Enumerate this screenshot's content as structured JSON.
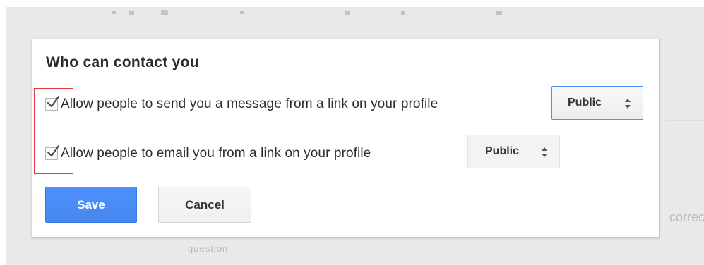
{
  "background": {
    "right_fragment": "correc",
    "bottom_fragment": "question"
  },
  "dialog": {
    "title": "Who can contact you",
    "options": [
      {
        "label": "Allow people to send you a message from a link on your profile",
        "checked": true,
        "visibility": "Public"
      },
      {
        "label": "Allow people to email you from a link on your profile",
        "checked": true,
        "visibility": "Public"
      }
    ],
    "save_label": "Save",
    "cancel_label": "Cancel"
  },
  "colors": {
    "primary_button": "#4d90fe",
    "highlight": "#e0393e",
    "focus_border": "#4d90fe"
  },
  "icons": {
    "check": "check-icon",
    "select_arrows": "updown-arrows-icon"
  }
}
